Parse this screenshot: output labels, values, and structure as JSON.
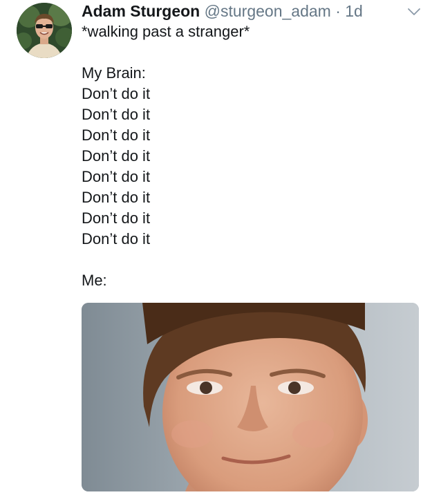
{
  "tweet": {
    "author_name": "Adam Sturgeon",
    "handle": "@sturgeon_adam",
    "separator": "·",
    "time": "1d",
    "caret_icon": "chevron-down-icon",
    "text": {
      "caption": "*walking past a stranger*",
      "brain_label": "My Brain:",
      "repeated_lines": [
        "Don’t do it",
        "Don’t do it",
        "Don’t do it",
        "Don’t do it",
        "Don’t do it",
        "Don’t do it",
        "Don’t do it",
        "Don’t do it"
      ],
      "me_label": "Me:"
    },
    "colors": {
      "text": "#14171a",
      "secondary": "#657786"
    }
  }
}
